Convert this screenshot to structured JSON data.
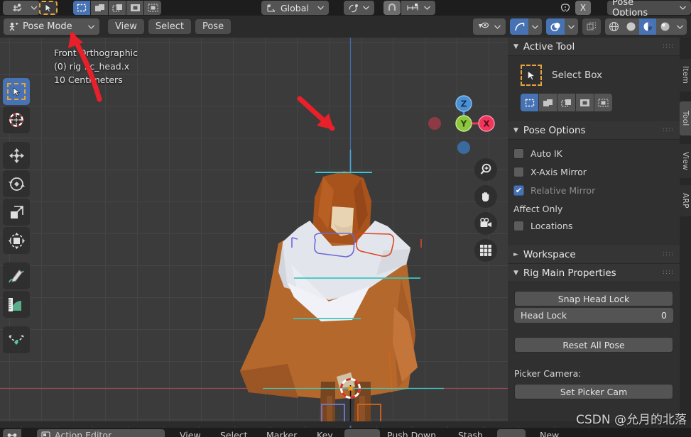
{
  "topbar": {
    "editor_type_icon": "editor-type-icon",
    "select_mode_icons": [
      "tweak-icon",
      "select-box-icon",
      "select-circle-icon",
      "select-lasso-icon",
      "select-extend-icon",
      "select-subtract-icon"
    ],
    "transform_orientation": "Global",
    "pivot_icon": "pivot-point-icon",
    "snap_icon": "snap-magnet-icon",
    "proportional_icon": "proportional-edit-icon",
    "mirror_icon": "x-axis-mirror-icon",
    "mirror_x_label": "X",
    "pose_options_label": "Pose Options"
  },
  "viewport_header": {
    "mode_icon": "pose-mode-icon",
    "mode_label": "Pose Mode",
    "menus": [
      "View",
      "Select",
      "Pose"
    ],
    "visibility_icon": "object-visibility-icon",
    "gizmo_icon": "show-gizmo-icon",
    "overlay_icon": "show-overlays-icon",
    "xray_icon": "toggle-xray-icon",
    "shading": [
      "wireframe-shading",
      "solid-shading",
      "material-preview-shading",
      "rendered-shading"
    ],
    "shading_active_index": 2
  },
  "viewport": {
    "view_name": "Front Orthographic",
    "collection_object": "(0) rig : c_head.x",
    "grid_scale": "10 Centimeters",
    "gizmo_axes": [
      {
        "label": "Z",
        "color": "#4b8fd6"
      },
      {
        "label": "Y",
        "color": "#8dc63f"
      },
      {
        "label": "X",
        "color": "#f1365b"
      }
    ],
    "nav_buttons": [
      "zoom-icon",
      "pan-hand-icon",
      "camera-view-icon",
      "toggle-ortho-grid-icon"
    ]
  },
  "toolbar": {
    "tools": [
      {
        "name": "select-box-tool",
        "active": true
      },
      {
        "name": "cursor-tool",
        "active": false
      },
      {
        "name": "move-tool",
        "active": false
      },
      {
        "name": "rotate-tool",
        "active": false
      },
      {
        "name": "scale-tool",
        "active": false
      },
      {
        "name": "transform-tool",
        "active": false
      },
      {
        "name": "annotate-tool",
        "active": false
      },
      {
        "name": "measure-tool",
        "active": false
      },
      {
        "name": "breakdowner-tool",
        "active": false
      }
    ]
  },
  "npanel": {
    "active_tool": {
      "title": "Active Tool",
      "tool_label": "Select Box",
      "mode_icons": [
        "set-new-selection",
        "extend-selection",
        "subtract-selection",
        "invert-selection",
        "intersect-selection"
      ],
      "mode_active_index": 0
    },
    "pose_options": {
      "title": "Pose Options",
      "items": [
        {
          "label": "Auto IK",
          "checked": false,
          "dim": false
        },
        {
          "label": "X-Axis Mirror",
          "checked": false,
          "dim": false
        },
        {
          "label": "Relative Mirror",
          "checked": true,
          "dim": true
        }
      ],
      "affect_only_label": "Affect Only",
      "affect_items": [
        {
          "label": "Locations",
          "checked": false,
          "dim": false
        }
      ]
    },
    "workspace": {
      "title": "Workspace",
      "expanded": false
    },
    "rig_main": {
      "title": "Rig Main Properties",
      "snap_head_lock_label": "Snap Head Lock",
      "head_lock_label": "Head Lock",
      "head_lock_value": "0",
      "reset_all_pose_label": "Reset All Pose",
      "picker_camera_label": "Picker Camera:",
      "set_picker_cam_label": "Set Picker Cam"
    },
    "tabs": [
      {
        "label": "Item",
        "active": false
      },
      {
        "label": "Tool",
        "active": true
      },
      {
        "label": "View",
        "active": false
      },
      {
        "label": "ARP",
        "active": false
      }
    ]
  },
  "dopesheet": {
    "editor_label": "Action Editor",
    "menus": [
      "View",
      "Select",
      "Marker",
      "Key"
    ],
    "push_down_label": "Push Down",
    "stash_label": "Stash",
    "new_label": "New"
  },
  "watermark": "CSDN @允月的北落",
  "colors": {
    "accent_blue": "#4772b3",
    "viewport_bg": "#3b3b3b",
    "panel_bg": "#303030",
    "header_bg": "#2b2b2b",
    "annotation_red": "#e8202a"
  }
}
